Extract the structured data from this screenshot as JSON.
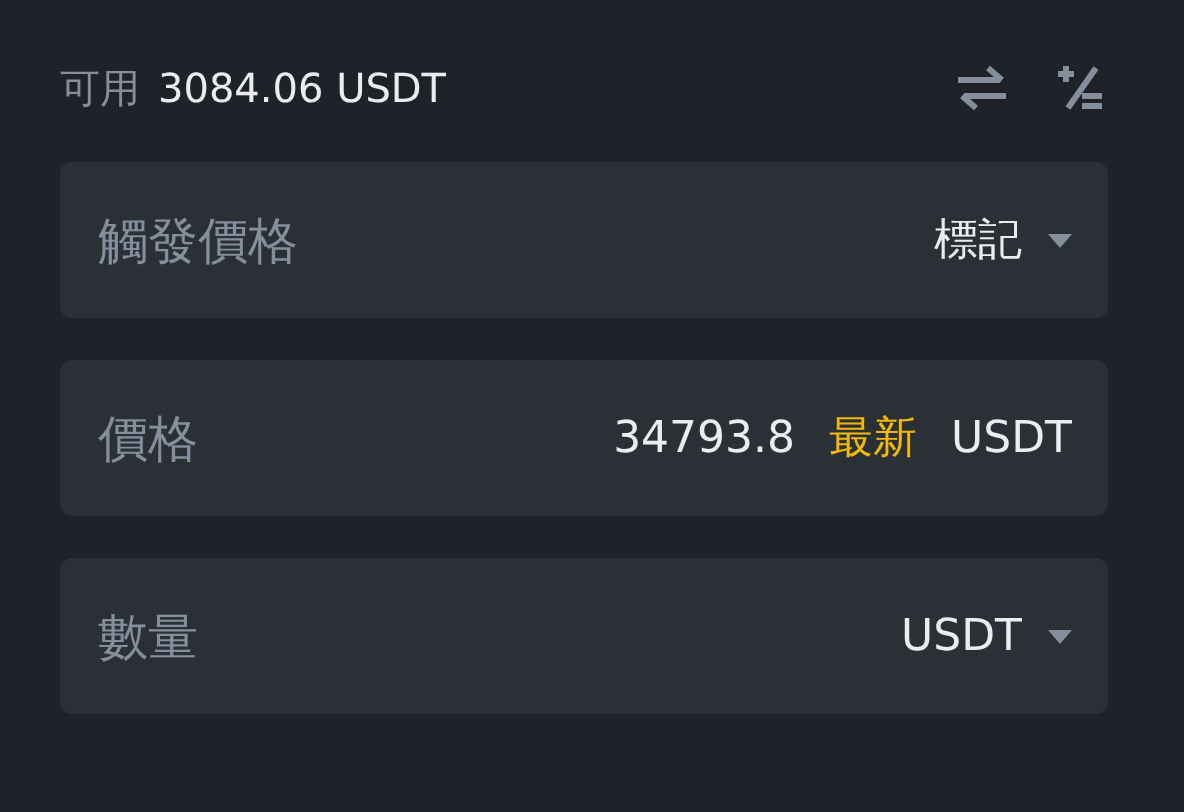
{
  "available": {
    "label": "可用",
    "amount": "3084.06 USDT"
  },
  "fields": [
    {
      "label": "觸發價格",
      "parts": [
        {
          "text": "標記",
          "kind": "value"
        }
      ],
      "dropdown": true
    },
    {
      "label": "價格",
      "parts": [
        {
          "text": "34793.8",
          "kind": "value"
        },
        {
          "text": "最新",
          "kind": "accent"
        },
        {
          "text": "USDT",
          "kind": "value"
        }
      ],
      "dropdown": false
    },
    {
      "label": "數量",
      "parts": [
        {
          "text": "USDT",
          "kind": "value"
        }
      ],
      "dropdown": true
    }
  ]
}
